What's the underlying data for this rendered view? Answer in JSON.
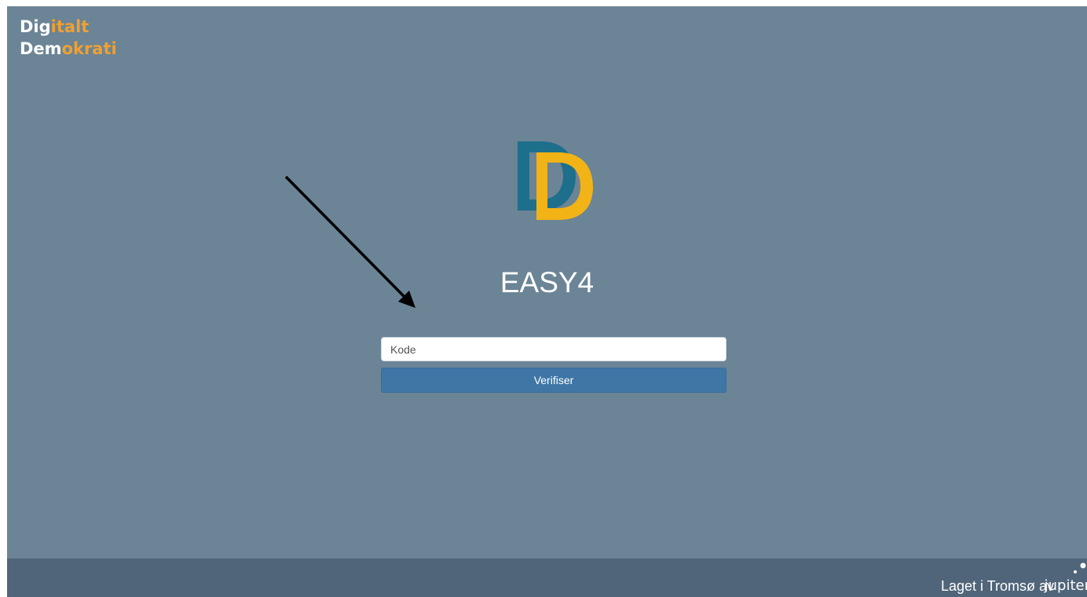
{
  "brand": {
    "line1_white": "Dig",
    "line1_orange": "italt",
    "line2_white": "Dem",
    "line2_orange": "okrati"
  },
  "logo": {
    "letter": "D",
    "back_color": "#1d6f8c",
    "front_color": "#f2b316"
  },
  "app": {
    "title": "EASY4"
  },
  "form": {
    "code_placeholder": "Kode",
    "code_value": "",
    "verify_label": "Verifiser"
  },
  "footer": {
    "made_in": "Laget i Tromsø av",
    "company": "jupiter"
  },
  "colors": {
    "background": "#6b8496",
    "accent_orange": "#f0a030",
    "button": "#3f76a6",
    "footer": "#506579"
  }
}
